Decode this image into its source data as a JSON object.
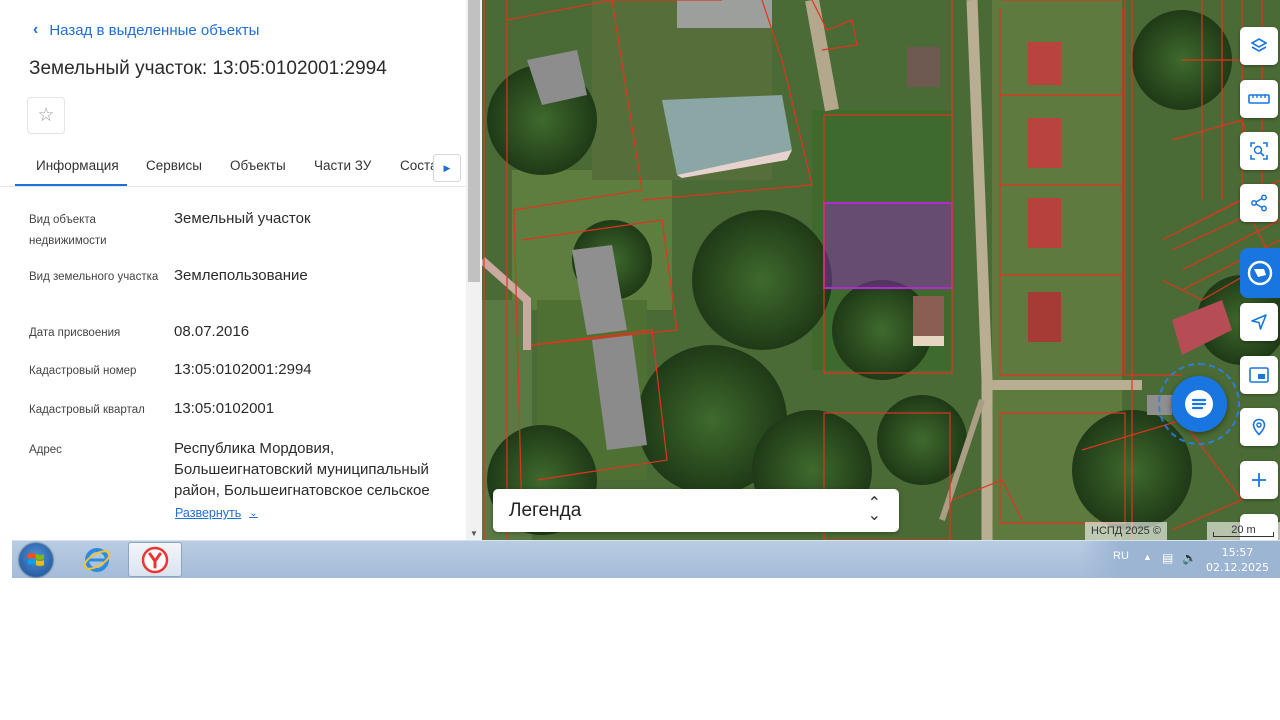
{
  "panel": {
    "back_label": "Назад в выделенные объекты",
    "title": "Земельный участок: 13:05:0102001:2994",
    "tabs": [
      {
        "label": "Информация",
        "active": true
      },
      {
        "label": "Сервисы"
      },
      {
        "label": "Объекты"
      },
      {
        "label": "Части ЗУ"
      },
      {
        "label": "Соста"
      }
    ],
    "fields": [
      {
        "label": "Вид объекта недвижимости",
        "value": "Земельный участок"
      },
      {
        "label": "Вид земельного участка",
        "value": "Землепользование"
      },
      {
        "label": "Дата присвоения",
        "value": "08.07.2016"
      },
      {
        "label": "Кадастровый номер",
        "value": "13:05:0102001:2994"
      },
      {
        "label": "Кадастровый квартал",
        "value": "13:05:0102001"
      },
      {
        "label": "Адрес",
        "value": "Республика Мордовия, Большеигнатовский муниципальный район, Большеигнатовское сельское"
      }
    ],
    "expand_label": "Развернуть"
  },
  "map": {
    "legend_title": "Легенда",
    "copyright": "НСПД 2025 ©",
    "scale_label": "20 m",
    "tools": [
      "layers-icon",
      "ruler-icon",
      "area-select-icon",
      "share-icon",
      "location-arrow-icon",
      "minimap-icon",
      "geo-search-icon",
      "zoom-in-icon"
    ],
    "boundary_color": "#e0341e",
    "selection_color": "#b02cd0"
  },
  "taskbar": {
    "lang": "RU",
    "time": "15:57",
    "date": "02.12.2025",
    "apps": [
      "windows-start-icon",
      "internet-explorer-icon",
      "yandex-browser-icon"
    ]
  }
}
